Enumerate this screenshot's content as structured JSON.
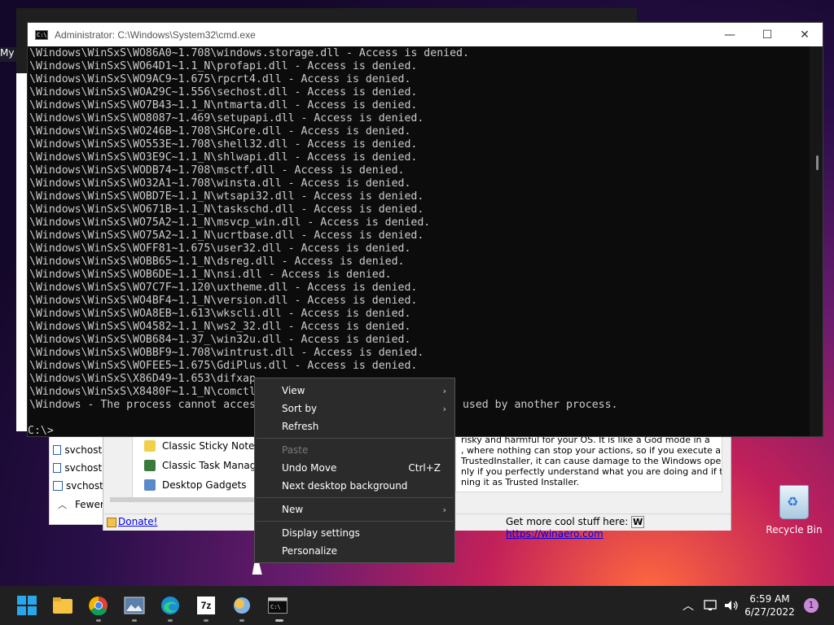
{
  "desktop": {
    "left_label": "My",
    "recycle_bin_label": "Recycle Bin"
  },
  "task_manager": {
    "processes": [
      "svchost.",
      "svchost.",
      "svchost"
    ],
    "fewer_label": "Fewer"
  },
  "winaero_tweaker": {
    "tree_items": [
      "Classic Sticky Notes",
      "Classic Task Manager &",
      "Desktop Gadgets"
    ],
    "description_lines": [
      "risky and harmful for your OS. It is like a God mode in a",
      ", where nothing can stop your actions, so if you execute a",
      "TrustedInstaller, it can cause damage to the Windows operating",
      "nly if you perfectly understand what you are doing and if there is",
      "ning it as Trusted Installer."
    ],
    "donate_label": "Donate!",
    "cool_stuff_label": "Get more cool stuff here:",
    "winaero_logo": "W",
    "winaero_link": "https://winaero.com"
  },
  "cmd": {
    "title": "Administrator: C:\\Windows\\System32\\cmd.exe",
    "lines": [
      "\\Windows\\WinSxS\\WO86A0~1.708\\windows.storage.dll - Access is denied.",
      "\\Windows\\WinSxS\\WO64D1~1.1_N\\profapi.dll - Access is denied.",
      "\\Windows\\WinSxS\\WO9AC9~1.675\\rpcrt4.dll - Access is denied.",
      "\\Windows\\WinSxS\\WOA29C~1.556\\sechost.dll - Access is denied.",
      "\\Windows\\WinSxS\\WO7B43~1.1_N\\ntmarta.dll - Access is denied.",
      "\\Windows\\WinSxS\\WO8087~1.469\\setupapi.dll - Access is denied.",
      "\\Windows\\WinSxS\\WO246B~1.708\\SHCore.dll - Access is denied.",
      "\\Windows\\WinSxS\\WO553E~1.708\\shell32.dll - Access is denied.",
      "\\Windows\\WinSxS\\WO3E9C~1.1_N\\shlwapi.dll - Access is denied.",
      "\\Windows\\WinSxS\\WODB74~1.708\\msctf.dll - Access is denied.",
      "\\Windows\\WinSxS\\WO32A1~1.708\\winsta.dll - Access is denied.",
      "\\Windows\\WinSxS\\WOBD7E~1.1_N\\wtsapi32.dll - Access is denied.",
      "\\Windows\\WinSxS\\WO671B~1.1_N\\taskschd.dll - Access is denied.",
      "\\Windows\\WinSxS\\WO75A2~1.1_N\\msvcp_win.dll - Access is denied.",
      "\\Windows\\WinSxS\\WO75A2~1.1_N\\ucrtbase.dll - Access is denied.",
      "\\Windows\\WinSxS\\WOFF81~1.675\\user32.dll - Access is denied.",
      "\\Windows\\WinSxS\\WOBB65~1.1_N\\dsreg.dll - Access is denied.",
      "\\Windows\\WinSxS\\WOB6DE~1.1_N\\nsi.dll - Access is denied.",
      "\\Windows\\WinSxS\\WO7C7F~1.120\\uxtheme.dll - Access is denied.",
      "\\Windows\\WinSxS\\WO4BF4~1.1_N\\version.dll - Access is denied.",
      "\\Windows\\WinSxS\\WOA8EB~1.613\\wkscli.dll - Access is denied.",
      "\\Windows\\WinSxS\\WO4582~1.1_N\\ws2_32.dll - Access is denied.",
      "\\Windows\\WinSxS\\WOB684~1.37_\\win32u.dll - Access is denied.",
      "\\Windows\\WinSxS\\WOBBF9~1.708\\wintrust.dll - Access is denied.",
      "\\Windows\\WinSxS\\WOFEE5~1.675\\GdiPlus.dll - Access is denied.",
      "\\Windows\\WinSxS\\X86D49~1.653\\difxap",
      "\\Windows\\WinSxS\\X8480F~1.1_N\\comctl",
      "\\Windows - The process cannot acces                                used by another process."
    ],
    "prompt": "C:\\>"
  },
  "context_menu": {
    "view": "View",
    "sort_by": "Sort by",
    "refresh": "Refresh",
    "paste": "Paste",
    "undo_move": "Undo Move",
    "undo_shortcut": "Ctrl+Z",
    "next_background": "Next desktop background",
    "new": "New",
    "display_settings": "Display settings",
    "personalize": "Personalize"
  },
  "taskbar": {
    "time": "6:59 AM",
    "date": "6/27/2022",
    "notification_count": "1",
    "sevenzip_label": "7z"
  }
}
